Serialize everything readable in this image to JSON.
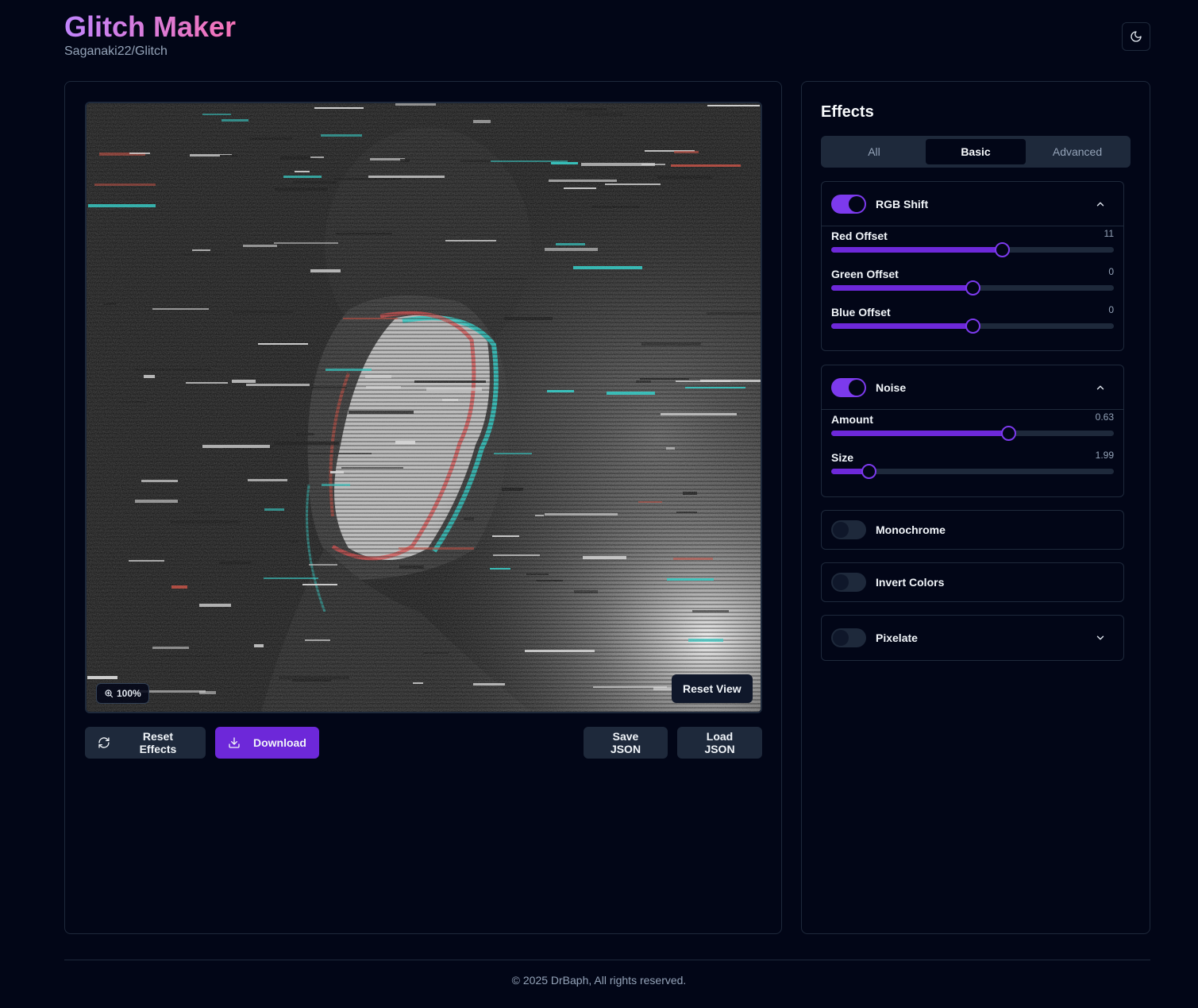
{
  "header": {
    "title": "Glitch Maker",
    "subtitle": "Saganaki22/Glitch"
  },
  "icons": {
    "theme_toggle": "moon-icon",
    "zoom": "zoom-in-icon",
    "reset": "refresh-icon",
    "download": "download-icon",
    "chevron_up": "chevron-up-icon",
    "chevron_down": "chevron-down-icon"
  },
  "canvas": {
    "zoom_label": "100%",
    "reset_view_label": "Reset View"
  },
  "actions": {
    "reset_effects": "Reset Effects",
    "download": "Download",
    "save_json": "Save JSON",
    "load_json": "Load JSON"
  },
  "effects": {
    "title": "Effects",
    "tabs": [
      {
        "label": "All",
        "active": false
      },
      {
        "label": "Basic",
        "active": true
      },
      {
        "label": "Advanced",
        "active": false
      }
    ],
    "rgb_shift": {
      "label": "RGB Shift",
      "enabled": true,
      "expanded": true,
      "sliders": [
        {
          "label": "Red Offset",
          "value": "11",
          "fraction": 0.605
        },
        {
          "label": "Green Offset",
          "value": "0",
          "fraction": 0.5
        },
        {
          "label": "Blue Offset",
          "value": "0",
          "fraction": 0.5
        }
      ]
    },
    "noise": {
      "label": "Noise",
      "enabled": true,
      "expanded": true,
      "sliders": [
        {
          "label": "Amount",
          "value": "0.63",
          "fraction": 0.625
        },
        {
          "label": "Size",
          "value": "1.99",
          "fraction": 0.133
        }
      ]
    },
    "monochrome": {
      "label": "Monochrome",
      "enabled": false
    },
    "invert_colors": {
      "label": "Invert Colors",
      "enabled": false
    },
    "pixelate": {
      "label": "Pixelate",
      "enabled": false,
      "expanded": false
    }
  },
  "footer": {
    "text": "© 2025 DrBaph, All rights reserved."
  },
  "colors": {
    "accent": "#7c3aed",
    "accent_fill": "#6d28d9",
    "background": "#020617",
    "border": "#1e293b",
    "title_gradient_start": "#c084fc",
    "title_gradient_end": "#f472b6"
  }
}
